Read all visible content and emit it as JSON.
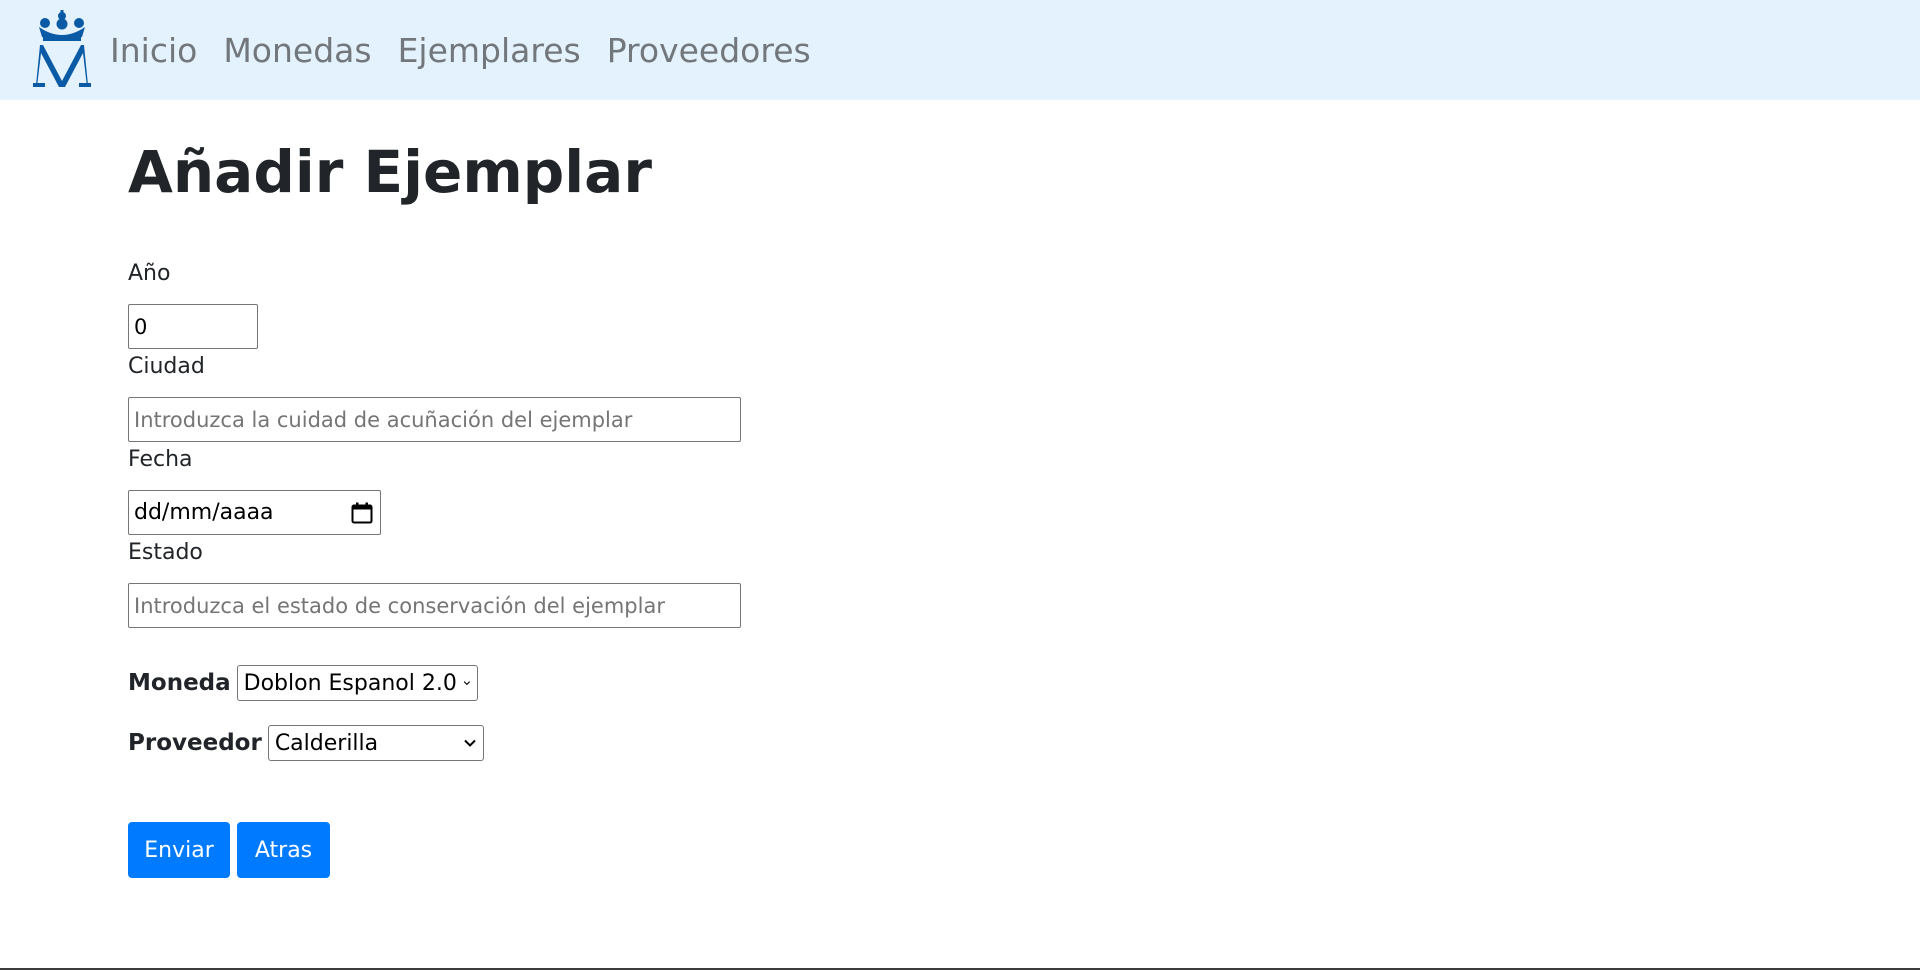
{
  "nav": {
    "brand_logo": "fnmt-crown-m-logo",
    "brand_color": "#0b5aa6",
    "background": "#e3f2fd",
    "links": [
      {
        "label": "Inicio"
      },
      {
        "label": "Monedas"
      },
      {
        "label": "Ejemplares"
      },
      {
        "label": "Proveedores"
      }
    ]
  },
  "page": {
    "title": "Añadir Ejemplar"
  },
  "form": {
    "anio": {
      "label": "Año",
      "value": "0"
    },
    "ciudad": {
      "label": "Ciudad",
      "placeholder": "Introduzca la cuidad de acuñación del ejemplar",
      "value": ""
    },
    "fecha": {
      "label": "Fecha",
      "value": "dd/mm/aaaa",
      "icon": "calendar-icon"
    },
    "estado": {
      "label": "Estado",
      "placeholder": "Introduzca el estado de conservación del ejemplar",
      "value": ""
    },
    "moneda": {
      "label": "Moneda",
      "selected": "Doblon Espanol 2.0"
    },
    "proveedor": {
      "label": "Proveedor",
      "selected": "Calderilla"
    }
  },
  "buttons": {
    "submit_label": "Enviar",
    "back_label": "Atras",
    "color": "#007bff"
  }
}
